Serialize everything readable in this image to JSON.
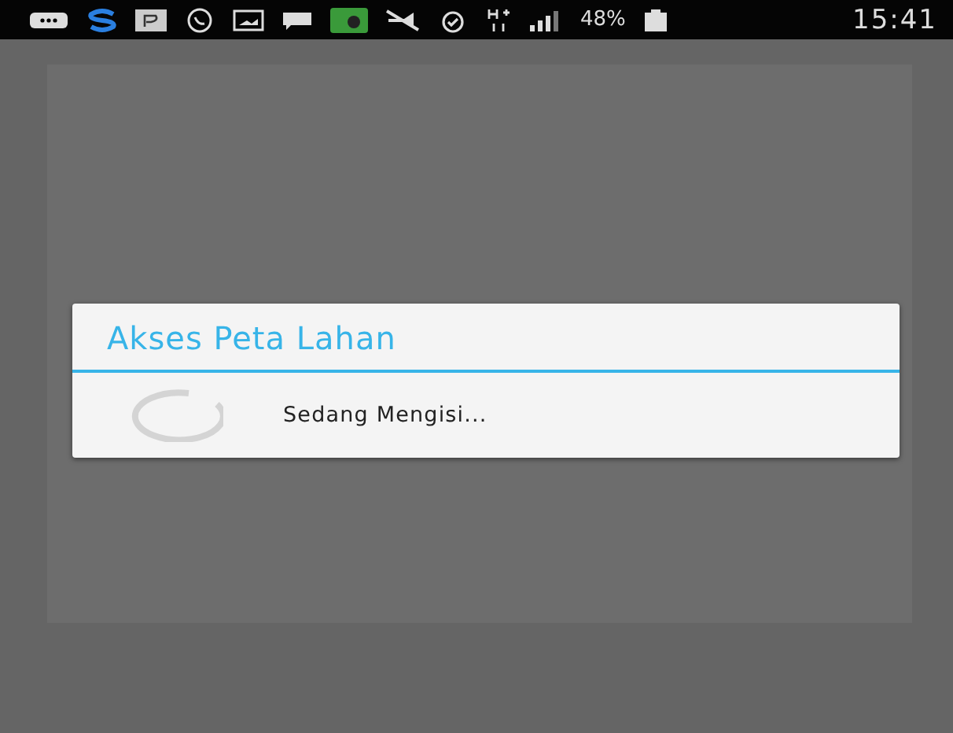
{
  "status_bar": {
    "battery_percent": "48%",
    "time": "15:41"
  },
  "dialog": {
    "title": "Akses Peta Lahan",
    "message": "Sedang Mengisi..."
  }
}
